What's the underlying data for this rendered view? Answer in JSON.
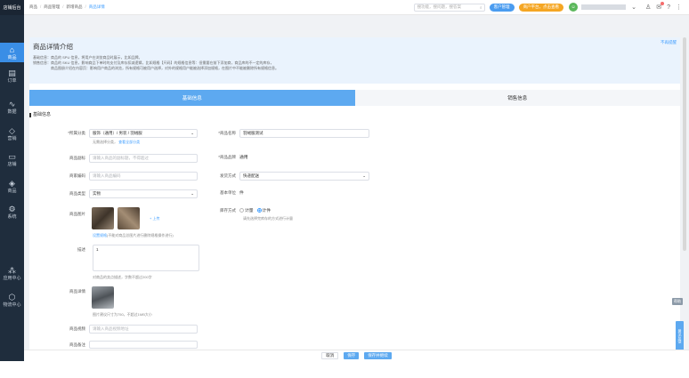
{
  "sidebar": {
    "logo": "店铺后台",
    "items": [
      {
        "label": "商品",
        "icon": "bag-icon"
      },
      {
        "label": "订单",
        "icon": "order-icon"
      },
      {
        "label": "数据",
        "icon": "chart-icon"
      },
      {
        "label": "营销",
        "icon": "share-icon"
      },
      {
        "label": "店铺",
        "icon": "store-icon"
      },
      {
        "label": "商品",
        "icon": "tag-icon"
      },
      {
        "label": "系统",
        "icon": "gear-icon"
      },
      {
        "label": "应用中心",
        "icon": "apps-icon"
      },
      {
        "label": "物流中心",
        "icon": "box-icon"
      }
    ]
  },
  "topbar": {
    "breadcrumb": [
      "商品",
      "商品管理",
      "新增商品",
      "商品详情"
    ],
    "search_placeholder": "搜功能，搜问题，搜答案",
    "pill_blue": "客户管理",
    "pill_orange": "商户平台，点击查看"
  },
  "intro": {
    "title": "商品详情介绍",
    "close": "不再提醒",
    "p1": "基础信息：商品的 SPU 信息，将用户在浏览商品时展示，比如品牌。",
    "p2": "销售信息：商品的 SKU 信息，影响商品下单时的支付及库存扣减逻辑，比如规格【尺码】的规格信息等：但需要在前下添加商，商品库的不一定的库存，",
    "p3": "商品图册介绍在内容页：影响用户商品的浏览，所有规格可被用户选择，对外的规格用户能被选择添加规格，在图片中不能被删除所有规格信息。"
  },
  "tabs": {
    "basic": "基础信息",
    "sales": "销售信息"
  },
  "section": "基础信息",
  "form": {
    "category_label": "*所属分类",
    "category_value": "服饰（通用）/ 男装 / 羽绒服",
    "category_tip": "无需选择分类，",
    "category_link": "查看全部分类",
    "name_label": "*商品名称",
    "name_value": "羽绒服测试",
    "sub_label": "商品副标",
    "sub_placeholder": "请输入商品的副标题，不得超过",
    "brand_label": "*商品品牌",
    "brand_value": "通用",
    "code_label": "商家编码",
    "code_placeholder": "请输入商品编码",
    "ship_label": "发货方式",
    "ship_value": "快递配送",
    "type_label": "商品类型",
    "type_value": "实物",
    "unit_label": "基本单位",
    "unit_value": "件",
    "images_label": "商品图片",
    "images_add": "+ 上传",
    "images_tip_link": "设置规格",
    "images_tip": "(不能对商品总图片进行删除规格操作进行)",
    "stock_label": "库存方式",
    "stock_opt1": "计量",
    "stock_opt2": "计件",
    "stock_tip": "请先选择完库存的方式进行计量",
    "desc_label": "描述",
    "desc_value": "1",
    "desc_tip": "对商品的卖点描述，字数不超过200字",
    "detail_label": "商品详情",
    "detail_tip": "图片建议尺寸为750，不超过1MB大小",
    "video_label": "商品视频",
    "video_placeholder": "请输入商品视频地址",
    "more_label": "商品备注"
  },
  "footer": {
    "cancel": "取消",
    "save": "保存",
    "save_next": "保存并继续"
  },
  "float": {
    "help": "帮助",
    "feedback": "意见反馈"
  }
}
